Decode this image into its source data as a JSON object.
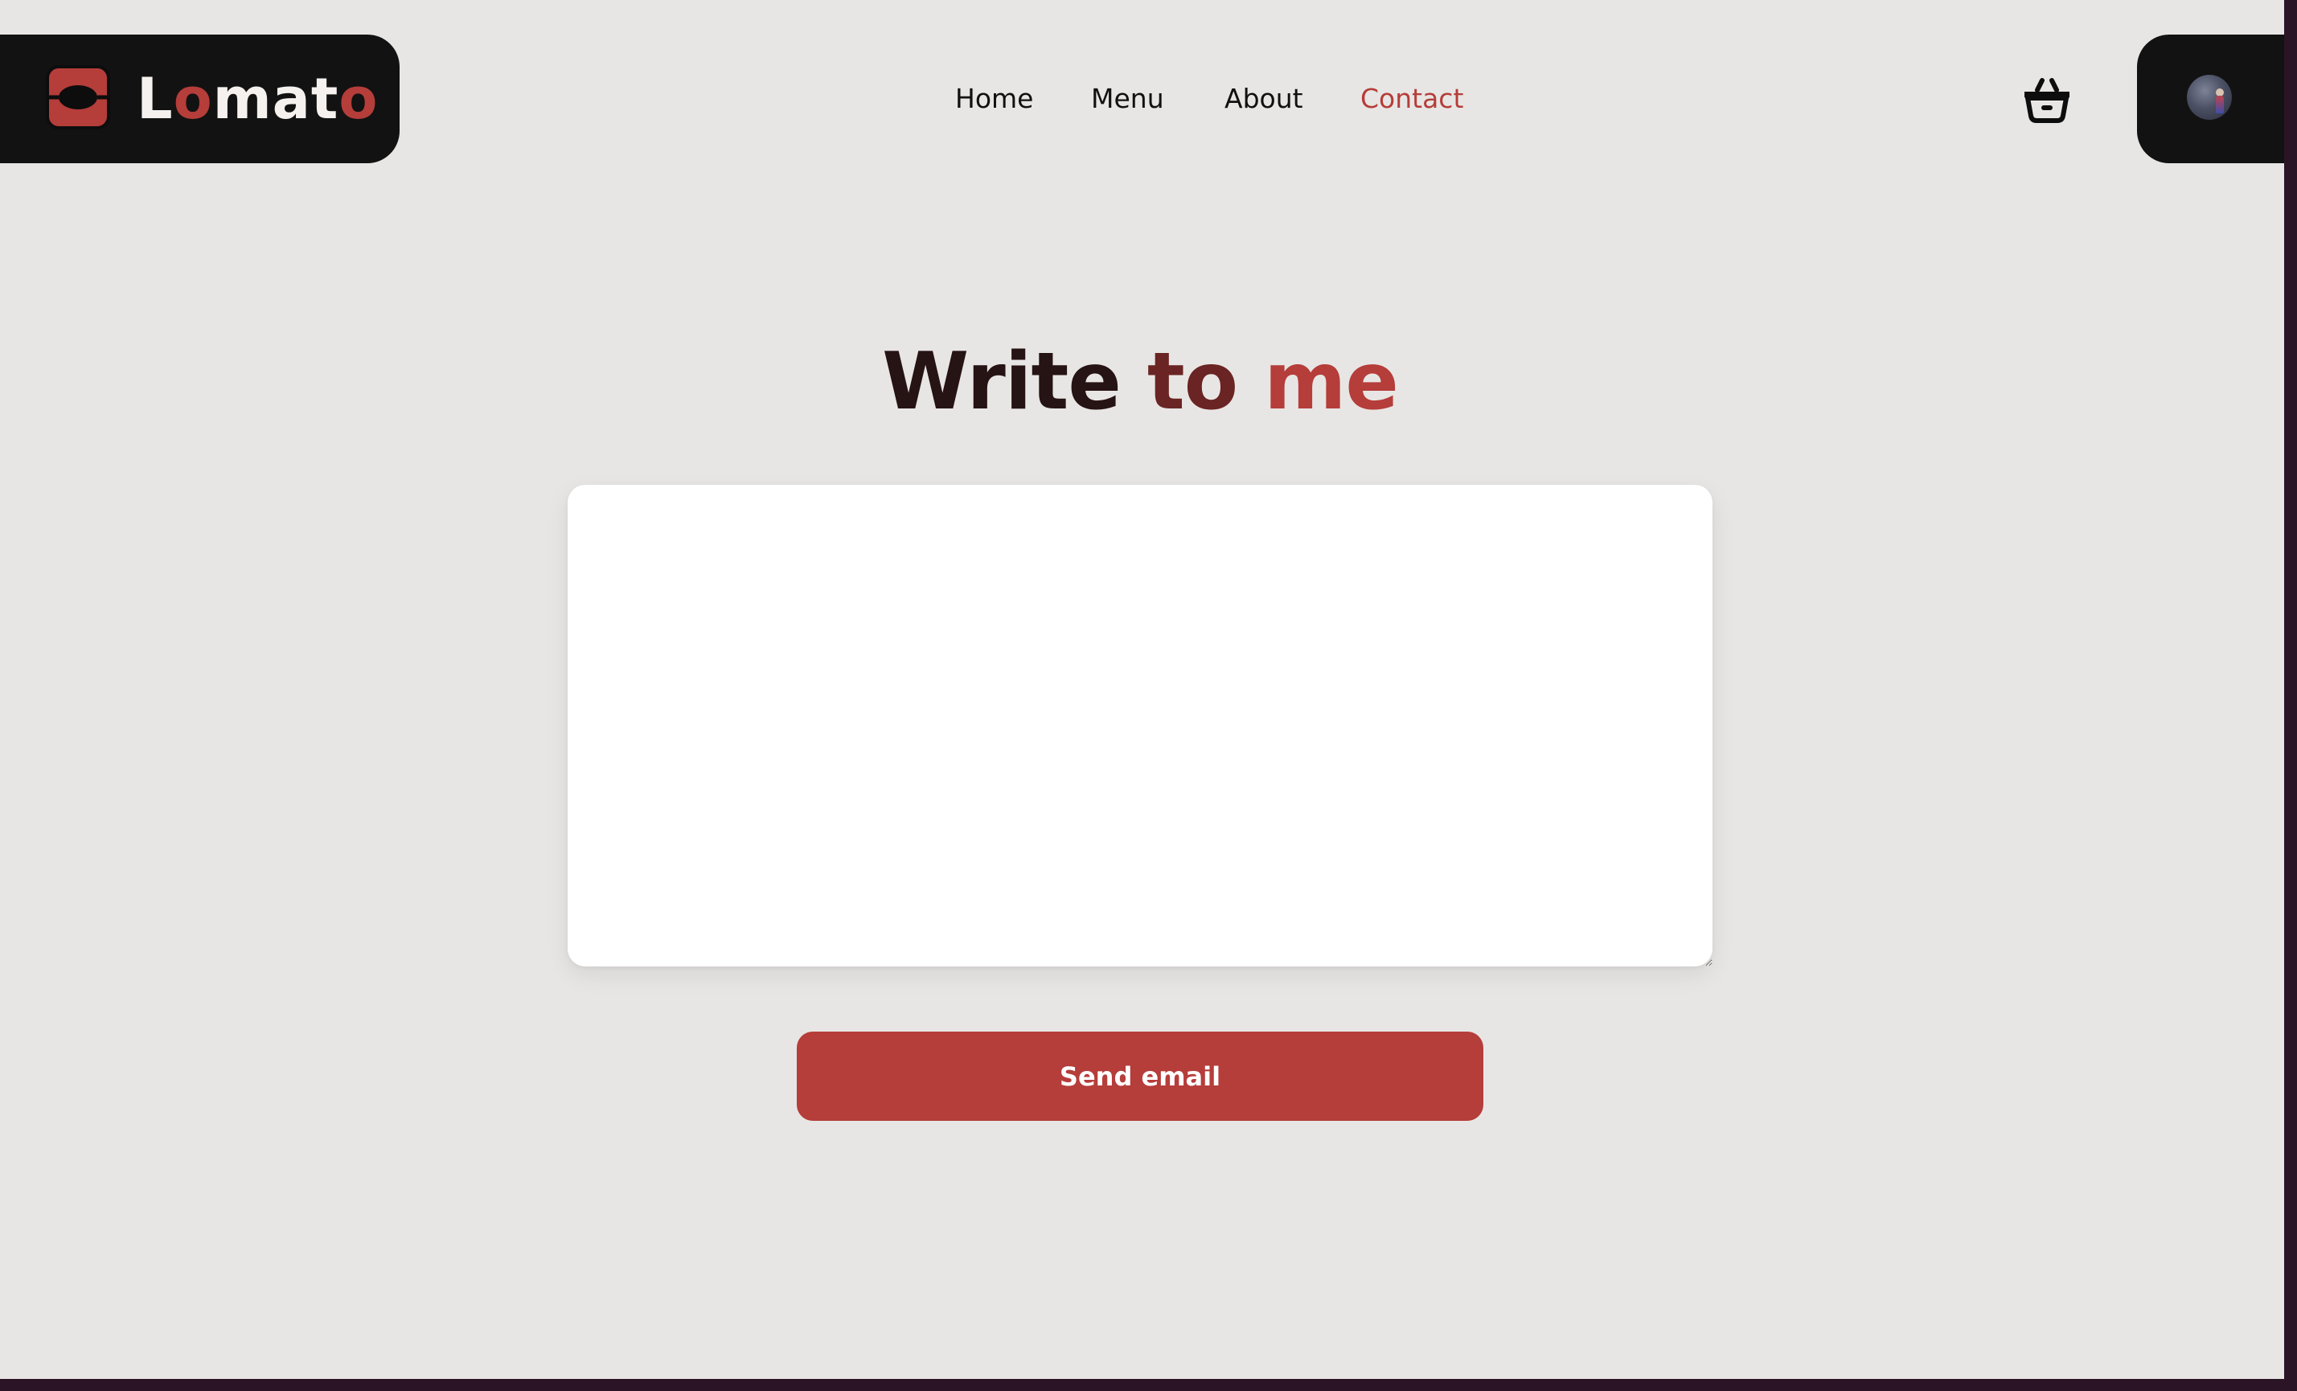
{
  "brand": {
    "logo_parts": [
      {
        "text": "L",
        "accent": false
      },
      {
        "text": "o",
        "accent": true
      },
      {
        "text": "mat",
        "accent": false
      },
      {
        "text": "o",
        "accent": true
      }
    ],
    "logo_icon": "plate-icon",
    "accent_color": "#b53d3a",
    "dark_color": "#121212"
  },
  "nav": {
    "items": [
      {
        "label": "Home",
        "active": false
      },
      {
        "label": "Menu",
        "active": false
      },
      {
        "label": "About",
        "active": false
      },
      {
        "label": "Contact",
        "active": true
      }
    ]
  },
  "header": {
    "cart_icon": "shopping-basket-icon",
    "avatar_icon": "user-avatar"
  },
  "main": {
    "heading_parts": [
      "Write",
      "to",
      "me"
    ],
    "message_value": "",
    "message_placeholder": "",
    "send_label": "Send email"
  },
  "colors": {
    "background": "#e8e6e4",
    "heading_dark": "#261314",
    "heading_mid": "#6a2423",
    "heading_accent": "#b53d3a",
    "button": "#b53d3a"
  }
}
